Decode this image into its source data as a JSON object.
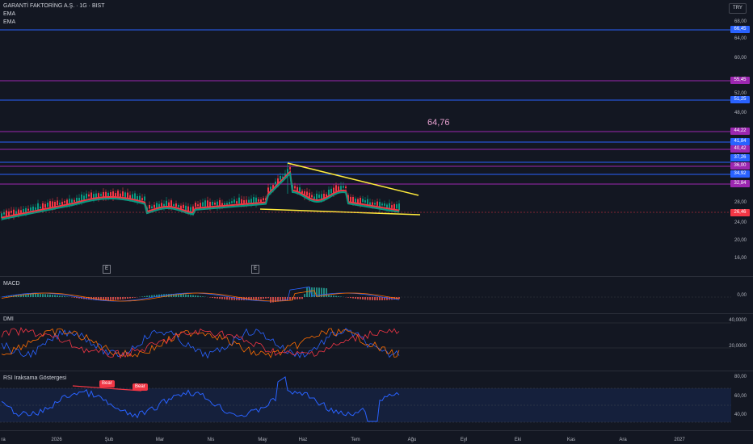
{
  "header": {
    "symbol_title": "GARANTİ FAKTORİNG A.Ş. · 1G · BIST",
    "indicator_1": "EMA",
    "indicator_2": "EMA",
    "currency": "TRY"
  },
  "price_axis": {
    "ticks": [
      "68,00",
      "64,00",
      "60,00",
      "52,00",
      "48,00",
      "28,00",
      "24,00",
      "20,00",
      "16,00"
    ]
  },
  "price_tags": [
    {
      "label": "66,45",
      "color": "#2962ff"
    },
    {
      "label": "55,45",
      "color": "#9c27b0"
    },
    {
      "label": "51,25",
      "color": "#2962ff"
    },
    {
      "label": "44,22",
      "color": "#9c27b0"
    },
    {
      "label": "41,84",
      "color": "#2962ff"
    },
    {
      "label": "40,42",
      "color": "#9c27b0"
    },
    {
      "label": "37,26",
      "color": "#2962ff"
    },
    {
      "label": "36,00",
      "color": "#9c27b0"
    },
    {
      "label": "34,92",
      "color": "#2962ff"
    },
    {
      "label": "32,84",
      "color": "#9c27b0"
    },
    {
      "label": "26,46",
      "color": "#f23645"
    }
  ],
  "annotation_value": "64,76",
  "earnings_marker": "E",
  "macd": {
    "label": "MACD",
    "tick": "0,00"
  },
  "dmi": {
    "label": "DMI",
    "ticks": [
      "40,0000",
      "20,0000"
    ]
  },
  "rsi": {
    "label": "RSI Iraksama Göstergesi",
    "ticks": [
      "80,00",
      "60,00",
      "40,00"
    ],
    "bear_1": "Bear",
    "bear_2": "Bear"
  },
  "time_axis": [
    "ra",
    "2026",
    "Şub",
    "Mar",
    "Nis",
    "May",
    "Haz",
    "Tem",
    "Ağu",
    "Eyl",
    "Eki",
    "Kas",
    "Ara",
    "2027"
  ],
  "colors": {
    "background": "#131722",
    "ema_fast": "#f23645",
    "ema_slow": "#089981",
    "wedge": "#ffeb3b",
    "blue_level": "#2962ff",
    "purple_level": "#9c27b0"
  }
}
